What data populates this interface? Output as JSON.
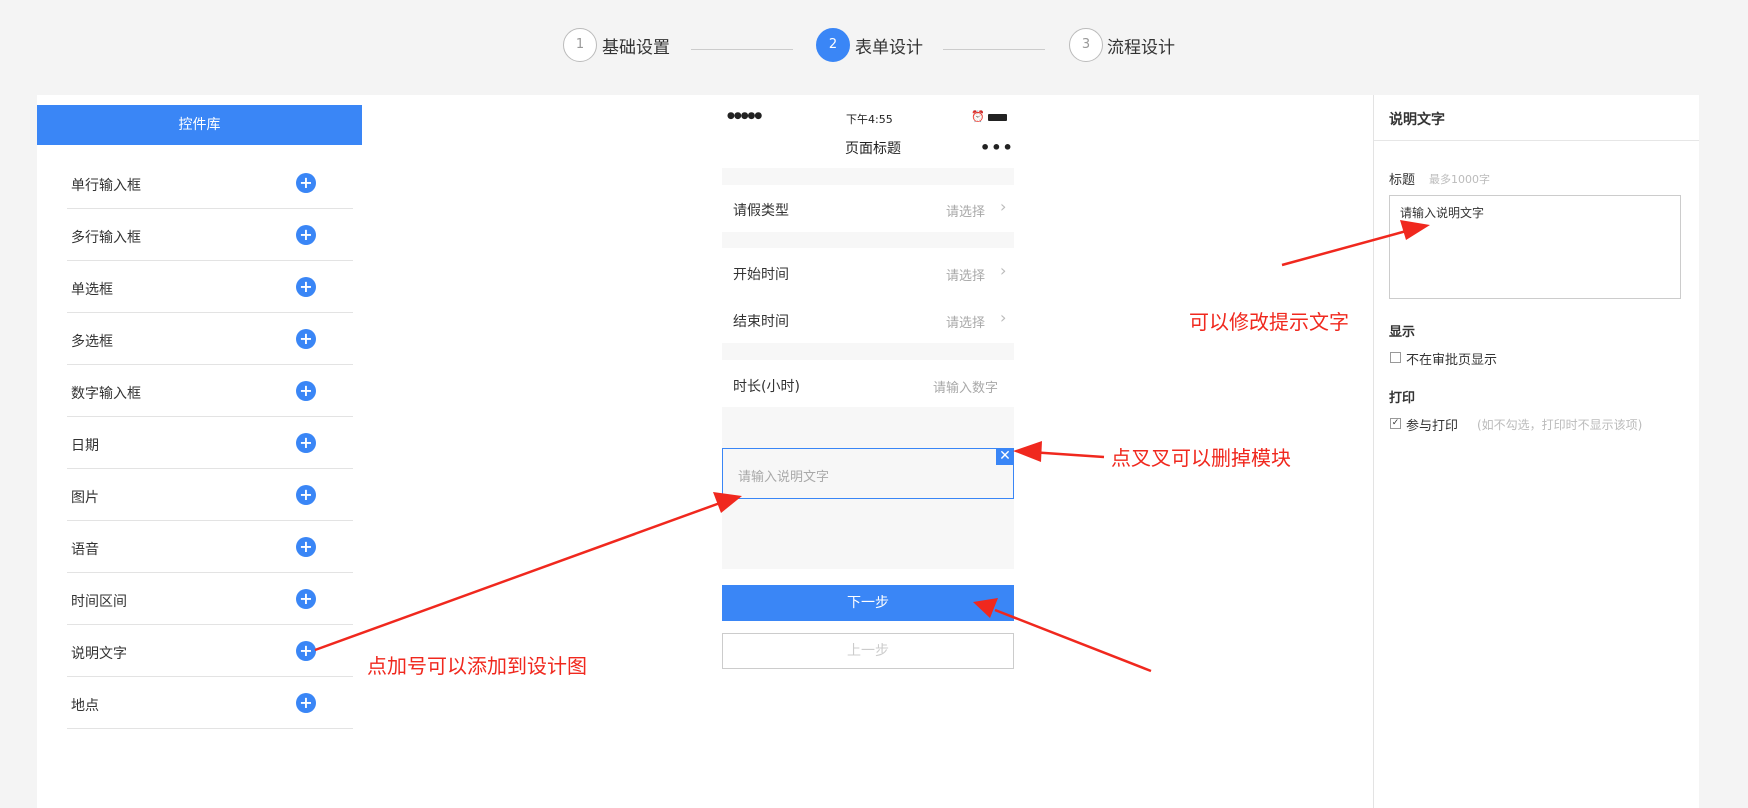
{
  "steps": [
    {
      "num": "1",
      "label": "基础设置",
      "active": false
    },
    {
      "num": "2",
      "label": "表单设计",
      "active": true
    },
    {
      "num": "3",
      "label": "流程设计",
      "active": false
    }
  ],
  "library": {
    "title": "控件库",
    "items": [
      "单行输入框",
      "多行输入框",
      "单选框",
      "多选框",
      "数字输入框",
      "日期",
      "图片",
      "语音",
      "时间区间",
      "说明文字",
      "地点"
    ],
    "add_icon": "+"
  },
  "phone": {
    "signal": "●●●●●",
    "time": "下午4:55",
    "page_title": "页面标题",
    "more": "•••",
    "fields": [
      {
        "label": "请假类型",
        "placeholder": "请选择"
      },
      {
        "label": "开始时间",
        "placeholder": "请选择"
      },
      {
        "label": "结束时间",
        "placeholder": "请选择"
      },
      {
        "label": "时长(小时)",
        "placeholder": "请输入数字"
      }
    ],
    "desc_placeholder": "请输入说明文字",
    "close_icon": "✕",
    "next_button": "下一步",
    "prev_button": "上一步"
  },
  "properties": {
    "title": "说明文字",
    "field_label": "标题",
    "field_hint": "最多1000字",
    "textarea_value": "请输入说明文字",
    "display_label": "显示",
    "display_option": "不在审批页显示",
    "display_checked": false,
    "print_label": "打印",
    "print_option": "参与打印",
    "print_checked": true,
    "print_hint": "(如不勾选，打印时不显示该项)"
  },
  "annotations": {
    "modify_hint": "可以修改提示文字",
    "delete_hint": "点叉叉可以删掉模块",
    "add_hint": "点加号可以添加到设计图"
  },
  "colors": {
    "accent": "#3a86f6",
    "annotation": "#f0281e"
  }
}
